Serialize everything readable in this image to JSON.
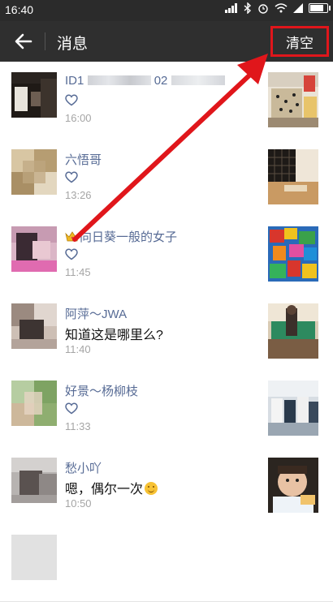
{
  "status_bar": {
    "time": "16:40"
  },
  "header": {
    "title": "消息",
    "clear_label": "清空"
  },
  "messages": [
    {
      "nick": "ID1",
      "nick_tail": "02",
      "content": "",
      "time": "16:00",
      "liked": true
    },
    {
      "nick": "六悟哥",
      "content": "",
      "time": "13:26",
      "liked": true
    },
    {
      "nick": "向日葵一般的女子",
      "content": "",
      "time": "11:45",
      "liked": true,
      "crown": true
    },
    {
      "nick": "阿萍～JWA",
      "content": "知道这是哪里么?",
      "time": "11:40",
      "liked": false
    },
    {
      "nick": "好景～杨柳枝",
      "content": "",
      "time": "11:33",
      "liked": true
    },
    {
      "nick": "愁小吖",
      "content": "嗯，偶尔一次",
      "time": "10:50",
      "liked": false,
      "emoji": true
    }
  ],
  "colors": {
    "accent_red": "#e0161b",
    "nick_blue": "#576b95",
    "header_bg": "#2f2f2f"
  }
}
